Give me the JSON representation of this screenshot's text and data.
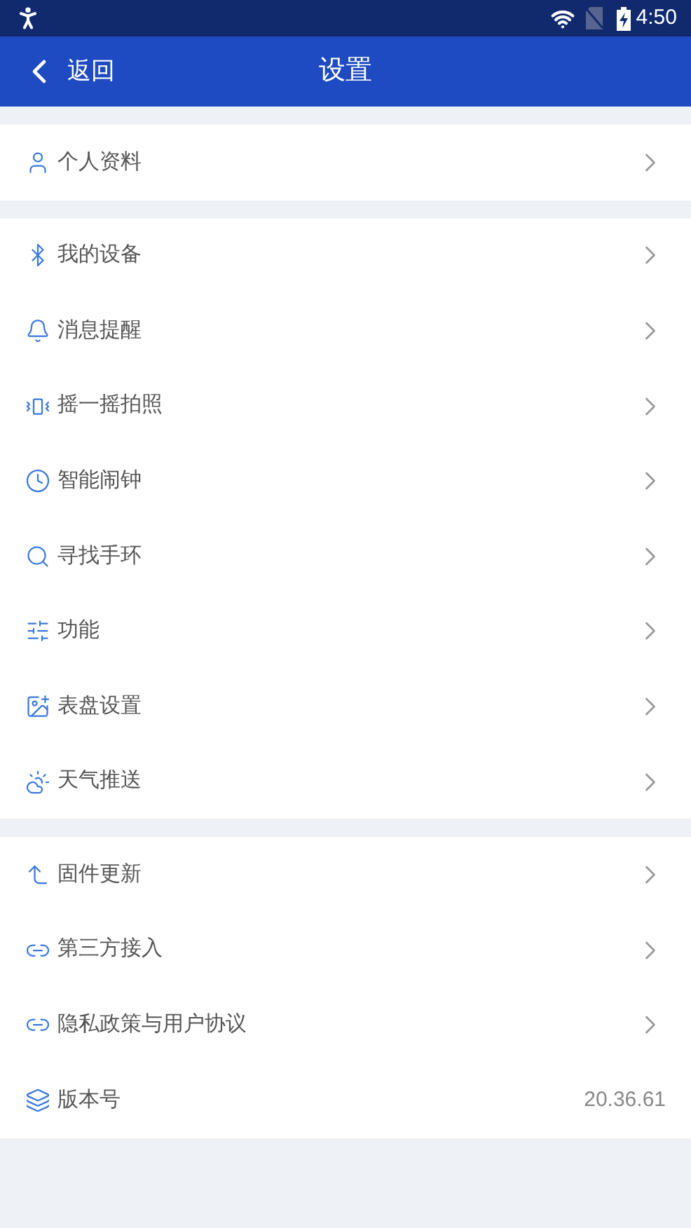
{
  "status_bar": {
    "time": "4:50"
  },
  "app_bar": {
    "back": "返回",
    "title": "设置"
  },
  "sections": [
    {
      "items": [
        {
          "kind": "link",
          "label": "个人资料"
        }
      ]
    },
    {
      "items": [
        {
          "kind": "link",
          "label": "我的设备"
        },
        {
          "kind": "link",
          "label": "消息提醒"
        },
        {
          "kind": "link",
          "label": "摇一摇拍照"
        },
        {
          "kind": "link",
          "label": "智能闹钟"
        },
        {
          "kind": "link",
          "label": "寻找手环"
        },
        {
          "kind": "link",
          "label": "功能"
        },
        {
          "kind": "link",
          "label": "表盘设置"
        },
        {
          "kind": "link",
          "label": "天气推送"
        }
      ]
    },
    {
      "items": [
        {
          "kind": "link",
          "label": "固件更新"
        },
        {
          "kind": "link",
          "label": "第三方接入"
        },
        {
          "kind": "link",
          "label": "隐私政策与用户协议"
        },
        {
          "kind": "value",
          "label": "版本号",
          "value": "20.36.61"
        }
      ]
    }
  ]
}
